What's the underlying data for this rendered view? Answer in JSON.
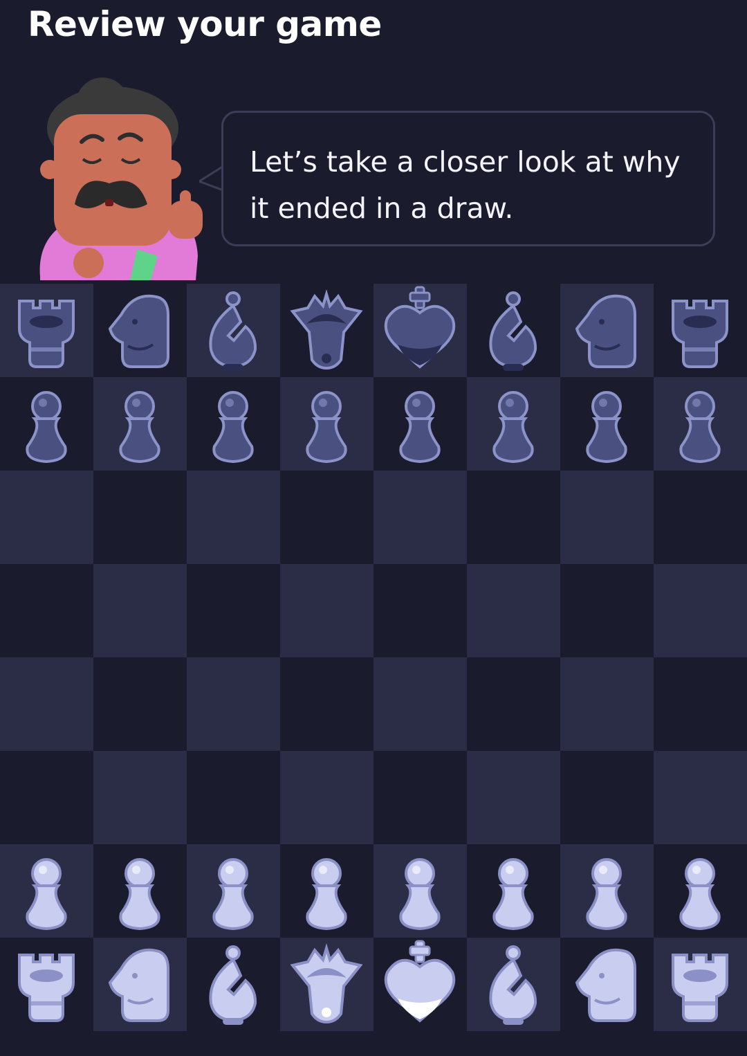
{
  "header": {
    "title": "Review your game"
  },
  "coach": {
    "message": "Let’s take a closer look at why it ended in a draw."
  },
  "board": {
    "colors": {
      "light": "#2a2d45",
      "dark": "#1b1b2e",
      "black_piece": "#4a5080",
      "black_outline": "#8b93c9",
      "white_piece": "#c9cdf0",
      "white_shade": "#8b90c6"
    },
    "rows": [
      [
        "bR",
        "bN",
        "bB",
        "bQ",
        "bK",
        "bB",
        "bN",
        "bR"
      ],
      [
        "bP",
        "bP",
        "bP",
        "bP",
        "bP",
        "bP",
        "bP",
        "bP"
      ],
      [
        "",
        "",
        "",
        "",
        "",
        "",
        "",
        ""
      ],
      [
        "",
        "",
        "",
        "",
        "",
        "",
        "",
        ""
      ],
      [
        "",
        "",
        "",
        "",
        "",
        "",
        "",
        ""
      ],
      [
        "",
        "",
        "",
        "",
        "",
        "",
        "",
        ""
      ],
      [
        "wP",
        "wP",
        "wP",
        "wP",
        "wP",
        "wP",
        "wP",
        "wP"
      ],
      [
        "wR",
        "wN",
        "wB",
        "wQ",
        "wK",
        "wB",
        "wN",
        "wR"
      ]
    ],
    "piece_names": {
      "R": "rook",
      "N": "knight",
      "B": "bishop",
      "Q": "queen",
      "K": "king",
      "P": "pawn"
    }
  }
}
